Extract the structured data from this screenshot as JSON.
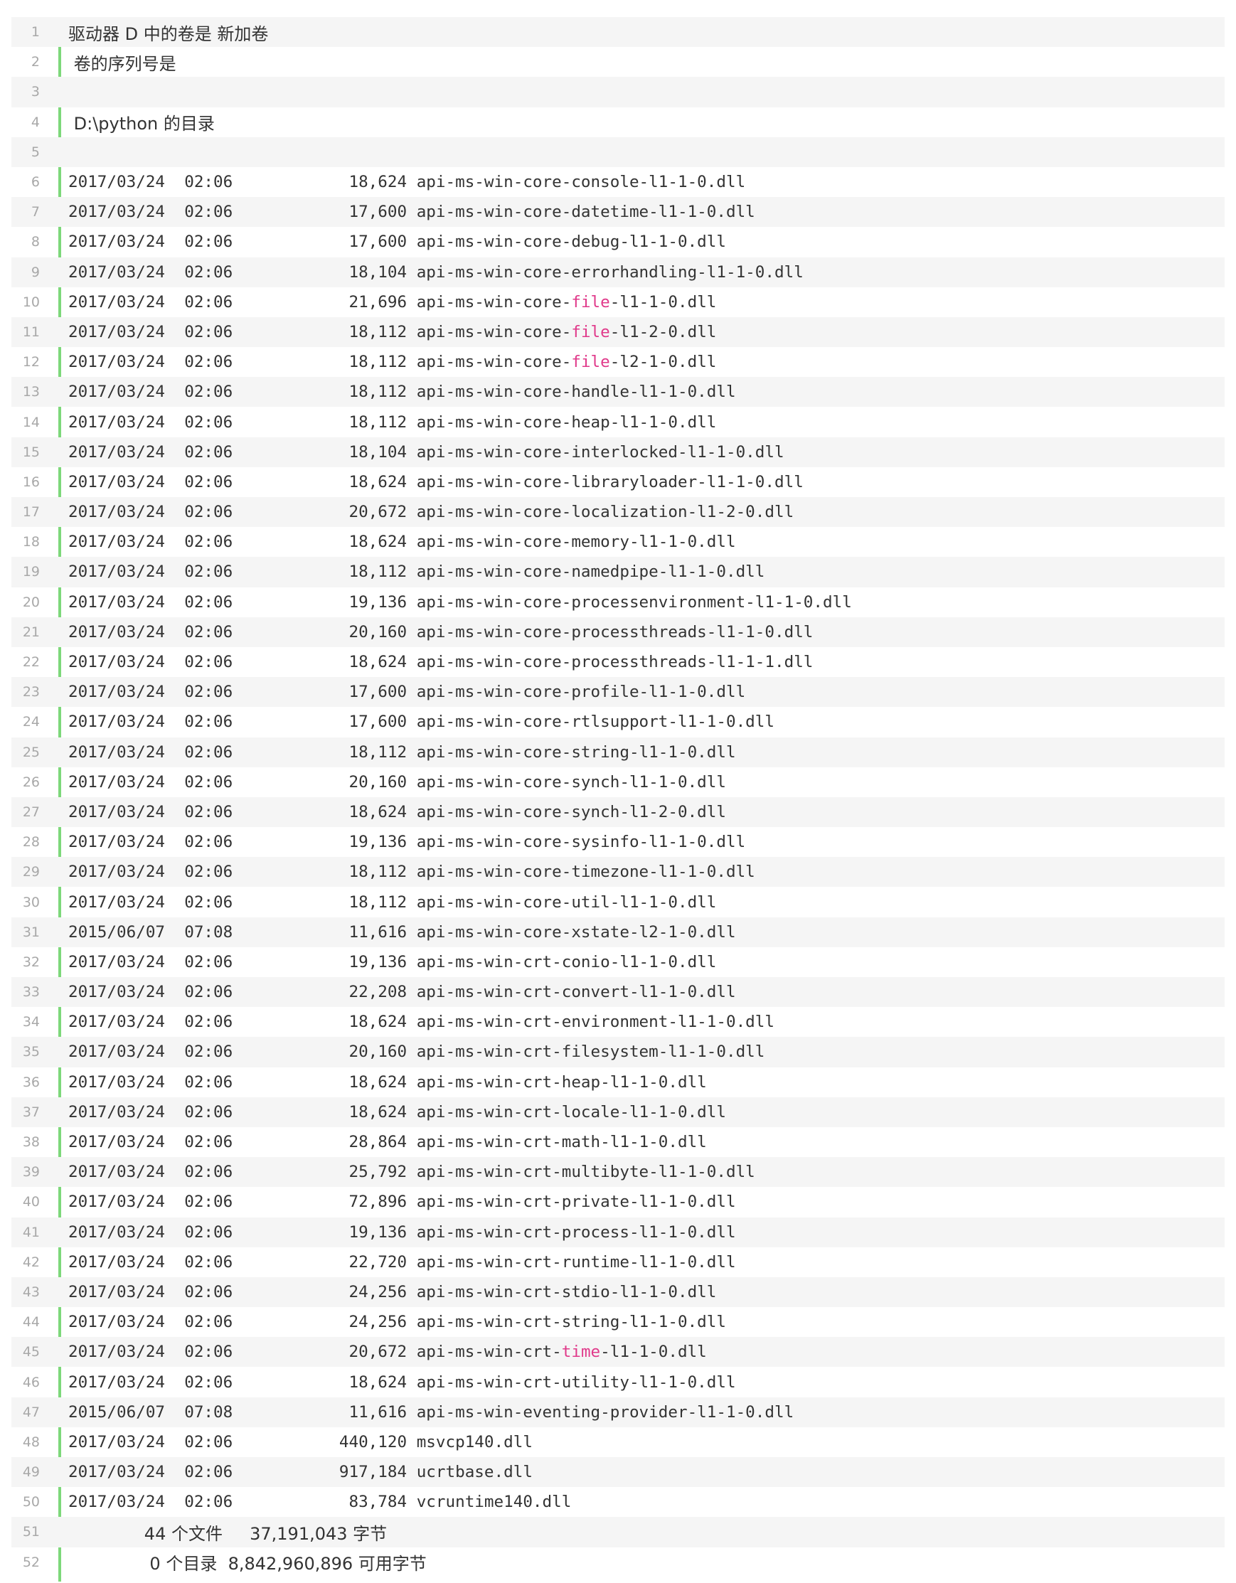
{
  "colors": {
    "highlight": "#e0398a",
    "rule": "#7dd87a",
    "stripe": "#f5f5f5",
    "line_number": "#a8a8a8",
    "text": "#333333"
  },
  "lines": [
    {
      "n": "1",
      "segments": [
        {
          "t": "驱动器 D 中的卷是 新加卷"
        }
      ]
    },
    {
      "n": "2",
      "segments": [
        {
          "t": " 卷的序列号是"
        }
      ]
    },
    {
      "n": "3",
      "segments": [
        {
          "t": ""
        }
      ]
    },
    {
      "n": "4",
      "segments": [
        {
          "t": " D:\\python 的目录"
        }
      ]
    },
    {
      "n": "5",
      "segments": [
        {
          "t": ""
        }
      ]
    },
    {
      "n": "6",
      "segments": [
        {
          "t": "2017/03/24  02:06            18,624 api-ms-win-core-console-l1-1-0.dll"
        }
      ]
    },
    {
      "n": "7",
      "segments": [
        {
          "t": "2017/03/24  02:06            17,600 api-ms-win-core-datetime-l1-1-0.dll"
        }
      ]
    },
    {
      "n": "8",
      "segments": [
        {
          "t": "2017/03/24  02:06            17,600 api-ms-win-core-debug-l1-1-0.dll"
        }
      ]
    },
    {
      "n": "9",
      "segments": [
        {
          "t": "2017/03/24  02:06            18,104 api-ms-win-core-errorhandling-l1-1-0.dll"
        }
      ]
    },
    {
      "n": "10",
      "segments": [
        {
          "t": "2017/03/24  02:06            21,696 api-ms-win-core-"
        },
        {
          "t": "file",
          "hl": true
        },
        {
          "t": "-l1-1-0.dll"
        }
      ]
    },
    {
      "n": "11",
      "segments": [
        {
          "t": "2017/03/24  02:06            18,112 api-ms-win-core-"
        },
        {
          "t": "file",
          "hl": true
        },
        {
          "t": "-l1-2-0.dll"
        }
      ]
    },
    {
      "n": "12",
      "segments": [
        {
          "t": "2017/03/24  02:06            18,112 api-ms-win-core-"
        },
        {
          "t": "file",
          "hl": true
        },
        {
          "t": "-l2-1-0.dll"
        }
      ]
    },
    {
      "n": "13",
      "segments": [
        {
          "t": "2017/03/24  02:06            18,112 api-ms-win-core-handle-l1-1-0.dll"
        }
      ]
    },
    {
      "n": "14",
      "segments": [
        {
          "t": "2017/03/24  02:06            18,112 api-ms-win-core-heap-l1-1-0.dll"
        }
      ]
    },
    {
      "n": "15",
      "segments": [
        {
          "t": "2017/03/24  02:06            18,104 api-ms-win-core-interlocked-l1-1-0.dll"
        }
      ]
    },
    {
      "n": "16",
      "segments": [
        {
          "t": "2017/03/24  02:06            18,624 api-ms-win-core-libraryloader-l1-1-0.dll"
        }
      ]
    },
    {
      "n": "17",
      "segments": [
        {
          "t": "2017/03/24  02:06            20,672 api-ms-win-core-localization-l1-2-0.dll"
        }
      ]
    },
    {
      "n": "18",
      "segments": [
        {
          "t": "2017/03/24  02:06            18,624 api-ms-win-core-memory-l1-1-0.dll"
        }
      ]
    },
    {
      "n": "19",
      "segments": [
        {
          "t": "2017/03/24  02:06            18,112 api-ms-win-core-namedpipe-l1-1-0.dll"
        }
      ]
    },
    {
      "n": "20",
      "segments": [
        {
          "t": "2017/03/24  02:06            19,136 api-ms-win-core-processenvironment-l1-1-0.dll"
        }
      ]
    },
    {
      "n": "21",
      "segments": [
        {
          "t": "2017/03/24  02:06            20,160 api-ms-win-core-processthreads-l1-1-0.dll"
        }
      ]
    },
    {
      "n": "22",
      "segments": [
        {
          "t": "2017/03/24  02:06            18,624 api-ms-win-core-processthreads-l1-1-1.dll"
        }
      ]
    },
    {
      "n": "23",
      "segments": [
        {
          "t": "2017/03/24  02:06            17,600 api-ms-win-core-profile-l1-1-0.dll"
        }
      ]
    },
    {
      "n": "24",
      "segments": [
        {
          "t": "2017/03/24  02:06            17,600 api-ms-win-core-rtlsupport-l1-1-0.dll"
        }
      ]
    },
    {
      "n": "25",
      "segments": [
        {
          "t": "2017/03/24  02:06            18,112 api-ms-win-core-string-l1-1-0.dll"
        }
      ]
    },
    {
      "n": "26",
      "segments": [
        {
          "t": "2017/03/24  02:06            20,160 api-ms-win-core-synch-l1-1-0.dll"
        }
      ]
    },
    {
      "n": "27",
      "segments": [
        {
          "t": "2017/03/24  02:06            18,624 api-ms-win-core-synch-l1-2-0.dll"
        }
      ]
    },
    {
      "n": "28",
      "segments": [
        {
          "t": "2017/03/24  02:06            19,136 api-ms-win-core-sysinfo-l1-1-0.dll"
        }
      ]
    },
    {
      "n": "29",
      "segments": [
        {
          "t": "2017/03/24  02:06            18,112 api-ms-win-core-timezone-l1-1-0.dll"
        }
      ]
    },
    {
      "n": "30",
      "segments": [
        {
          "t": "2017/03/24  02:06            18,112 api-ms-win-core-util-l1-1-0.dll"
        }
      ]
    },
    {
      "n": "31",
      "segments": [
        {
          "t": "2015/06/07  07:08            11,616 api-ms-win-core-xstate-l2-1-0.dll"
        }
      ]
    },
    {
      "n": "32",
      "segments": [
        {
          "t": "2017/03/24  02:06            19,136 api-ms-win-crt-conio-l1-1-0.dll"
        }
      ]
    },
    {
      "n": "33",
      "segments": [
        {
          "t": "2017/03/24  02:06            22,208 api-ms-win-crt-convert-l1-1-0.dll"
        }
      ]
    },
    {
      "n": "34",
      "segments": [
        {
          "t": "2017/03/24  02:06            18,624 api-ms-win-crt-environment-l1-1-0.dll"
        }
      ]
    },
    {
      "n": "35",
      "segments": [
        {
          "t": "2017/03/24  02:06            20,160 api-ms-win-crt-filesystem-l1-1-0.dll"
        }
      ]
    },
    {
      "n": "36",
      "segments": [
        {
          "t": "2017/03/24  02:06            18,624 api-ms-win-crt-heap-l1-1-0.dll"
        }
      ]
    },
    {
      "n": "37",
      "segments": [
        {
          "t": "2017/03/24  02:06            18,624 api-ms-win-crt-locale-l1-1-0.dll"
        }
      ]
    },
    {
      "n": "38",
      "segments": [
        {
          "t": "2017/03/24  02:06            28,864 api-ms-win-crt-math-l1-1-0.dll"
        }
      ]
    },
    {
      "n": "39",
      "segments": [
        {
          "t": "2017/03/24  02:06            25,792 api-ms-win-crt-multibyte-l1-1-0.dll"
        }
      ]
    },
    {
      "n": "40",
      "segments": [
        {
          "t": "2017/03/24  02:06            72,896 api-ms-win-crt-private-l1-1-0.dll"
        }
      ]
    },
    {
      "n": "41",
      "segments": [
        {
          "t": "2017/03/24  02:06            19,136 api-ms-win-crt-process-l1-1-0.dll"
        }
      ]
    },
    {
      "n": "42",
      "segments": [
        {
          "t": "2017/03/24  02:06            22,720 api-ms-win-crt-runtime-l1-1-0.dll"
        }
      ]
    },
    {
      "n": "43",
      "segments": [
        {
          "t": "2017/03/24  02:06            24,256 api-ms-win-crt-stdio-l1-1-0.dll"
        }
      ]
    },
    {
      "n": "44",
      "segments": [
        {
          "t": "2017/03/24  02:06            24,256 api-ms-win-crt-string-l1-1-0.dll"
        }
      ]
    },
    {
      "n": "45",
      "segments": [
        {
          "t": "2017/03/24  02:06            20,672 api-ms-win-crt-"
        },
        {
          "t": "time",
          "hl": true
        },
        {
          "t": "-l1-1-0.dll"
        }
      ]
    },
    {
      "n": "46",
      "segments": [
        {
          "t": "2017/03/24  02:06            18,624 api-ms-win-crt-utility-l1-1-0.dll"
        }
      ]
    },
    {
      "n": "47",
      "segments": [
        {
          "t": "2015/06/07  07:08            11,616 api-ms-win-eventing-provider-l1-1-0.dll"
        }
      ]
    },
    {
      "n": "48",
      "segments": [
        {
          "t": "2017/03/24  02:06           440,120 msvcp140.dll"
        }
      ]
    },
    {
      "n": "49",
      "segments": [
        {
          "t": "2017/03/24  02:06           917,184 ucrtbase.dll"
        }
      ]
    },
    {
      "n": "50",
      "segments": [
        {
          "t": "2017/03/24  02:06            83,784 vcruntime140.dll"
        }
      ]
    },
    {
      "n": "51",
      "segments": [
        {
          "t": "              44 个文件     37,191,043 字节"
        }
      ]
    },
    {
      "n": "52",
      "segments": [
        {
          "t": "               0 个目录  8,842,960,896 可用字节"
        }
      ]
    }
  ]
}
